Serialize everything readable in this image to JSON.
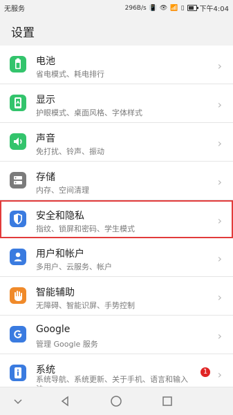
{
  "status": {
    "carrier": "无服务",
    "speed": "296B/s",
    "time": "下午4:04"
  },
  "page": {
    "title": "设置"
  },
  "items": [
    {
      "title": "电池",
      "subtitle": "省电模式、耗电排行",
      "icon": "battery-icon",
      "color": "#33c46c"
    },
    {
      "title": "显示",
      "subtitle": "护眼模式、桌面风格、字体样式",
      "icon": "display-icon",
      "color": "#33c46c"
    },
    {
      "title": "声音",
      "subtitle": "免打扰、铃声、振动",
      "icon": "sound-icon",
      "color": "#33c46c"
    },
    {
      "title": "存储",
      "subtitle": "内存、空间清理",
      "icon": "storage-icon",
      "color": "#7b7b7b"
    },
    {
      "title": "安全和隐私",
      "subtitle": "指纹、锁屏和密码、学生模式",
      "icon": "shield-icon",
      "color": "#3a7be0"
    },
    {
      "title": "用户和帐户",
      "subtitle": "多用户、云服务、帐户",
      "icon": "user-icon",
      "color": "#3a7be0"
    },
    {
      "title": "智能辅助",
      "subtitle": "无障碍、智能识屏、手势控制",
      "icon": "hand-icon",
      "color": "#f08a2a"
    },
    {
      "title": "Google",
      "subtitle": "管理 Google 服务",
      "icon": "google-icon",
      "color": "#3a7be0"
    },
    {
      "title": "系统",
      "subtitle": "系统导航、系统更新、关于手机、语言和输入法",
      "icon": "system-info-icon",
      "color": "#3a7be0",
      "badge": "1"
    }
  ],
  "nav": {
    "buttons": [
      "down-chevron-icon",
      "back-icon",
      "home-icon",
      "recents-icon"
    ]
  }
}
